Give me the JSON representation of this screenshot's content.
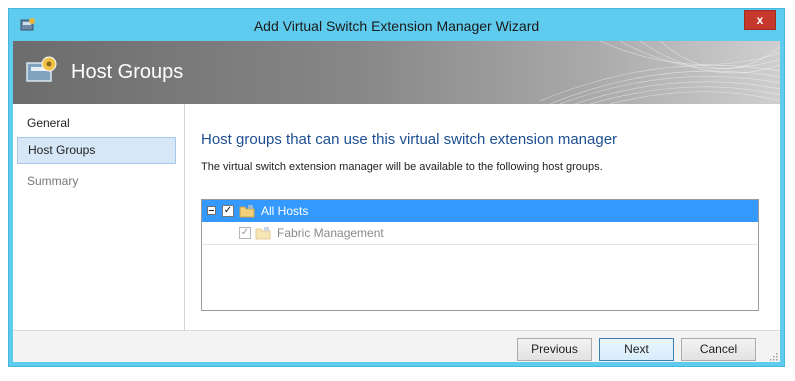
{
  "window": {
    "title": "Add Virtual Switch Extension Manager Wizard",
    "close_label": "x",
    "accent": "#5fcbee"
  },
  "banner": {
    "title": "Host Groups",
    "icon": "wizard-gear-icon"
  },
  "nav": {
    "items": [
      {
        "label": "General",
        "selected": false
      },
      {
        "label": "Host Groups",
        "selected": true
      },
      {
        "label": "Summary",
        "selected": false
      }
    ]
  },
  "content": {
    "heading": "Host groups that can use this virtual switch extension manager",
    "description": "The virtual switch extension manager will be available to the following host groups.",
    "tree": [
      {
        "label": "All Hosts",
        "checked": true,
        "expanded": true,
        "selected": true,
        "icon": "host-group-folder-icon"
      },
      {
        "label": "Fabric Management",
        "checked": true,
        "disabled": true,
        "icon": "host-group-folder-icon"
      }
    ]
  },
  "footer": {
    "previous_label": "Previous",
    "next_label": "Next",
    "cancel_label": "Cancel"
  }
}
